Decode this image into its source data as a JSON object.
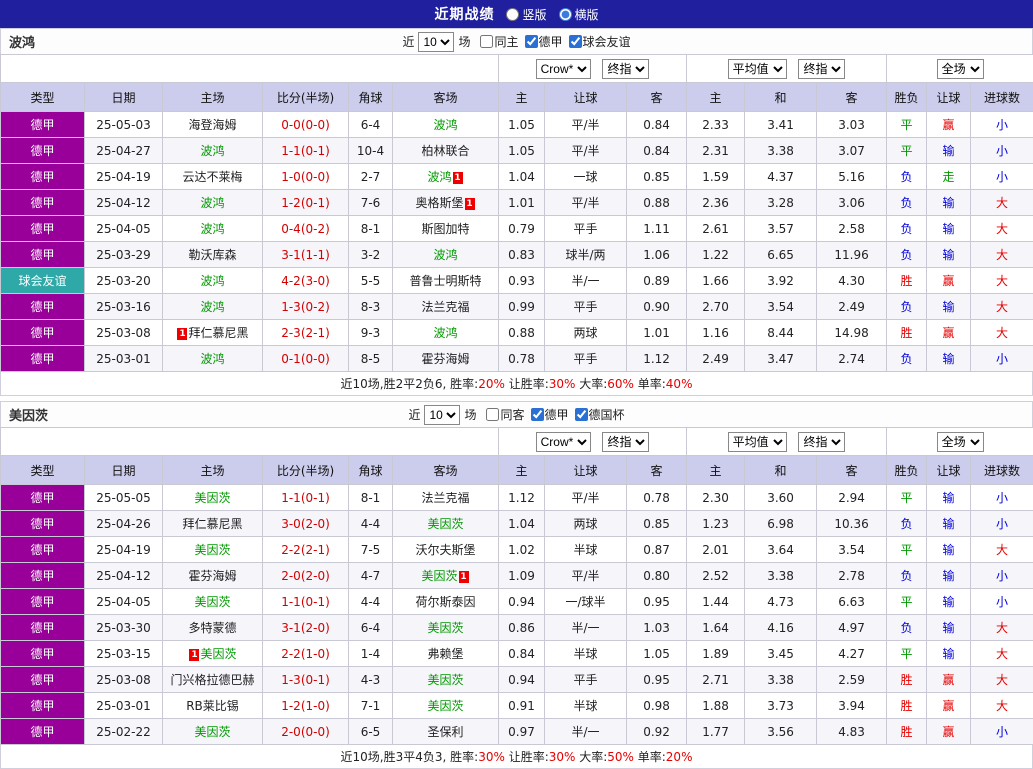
{
  "colors": {
    "title_bg": "#20209e",
    "header_bg": "#ccccec",
    "type_league": "#990099",
    "type_friendly": "#2fa8a8",
    "green": "#009900",
    "red": "#e60000",
    "blue": "#0000dd",
    "score_red": "#d40000"
  },
  "titlebar": {
    "title": "近期战绩",
    "radios": [
      {
        "label": "竖版",
        "selected": false
      },
      {
        "label": "横版",
        "selected": true
      }
    ]
  },
  "headers": [
    "类型",
    "日期",
    "主场",
    "比分(半场)",
    "角球",
    "客场",
    "主",
    "让球",
    "客",
    "主",
    "和",
    "客",
    "胜负",
    "让球",
    "进球数"
  ],
  "tables": [
    {
      "team": "波鸿",
      "filter": {
        "near_label": "近",
        "count": "10",
        "games_label": "场",
        "checks": [
          {
            "label": "同主",
            "checked": false
          },
          {
            "label": "德甲",
            "checked": true
          },
          {
            "label": "球会友谊",
            "checked": true
          }
        ]
      },
      "dropdowns": {
        "asia_company": "Crow*",
        "asia_time": "终指",
        "euro_company": "平均值",
        "euro_time": "终指",
        "scope": "全场"
      },
      "rows": [
        {
          "type": "德甲",
          "type_key": "league",
          "date": "25-05-03",
          "home": {
            "name": "海登海姆",
            "green": false,
            "card": null
          },
          "score": "0-0(0-0)",
          "corner": "6-4",
          "away": {
            "name": "波鸿",
            "green": true,
            "card": null
          },
          "asia": [
            "1.05",
            "平/半",
            "0.84"
          ],
          "europe": [
            "2.33",
            "3.41",
            "3.03"
          ],
          "result": {
            "text": "平",
            "color": "green"
          },
          "handicap": {
            "text": "赢",
            "color": "red"
          },
          "goal": {
            "text": "小",
            "color": "blue"
          }
        },
        {
          "type": "德甲",
          "type_key": "league",
          "date": "25-04-27",
          "home": {
            "name": "波鸿",
            "green": true,
            "card": null
          },
          "score": "1-1(0-1)",
          "corner": "10-4",
          "away": {
            "name": "柏林联合",
            "green": false,
            "card": null
          },
          "asia": [
            "1.05",
            "平/半",
            "0.84"
          ],
          "europe": [
            "2.31",
            "3.38",
            "3.07"
          ],
          "result": {
            "text": "平",
            "color": "green"
          },
          "handicap": {
            "text": "输",
            "color": "blue"
          },
          "goal": {
            "text": "小",
            "color": "blue"
          }
        },
        {
          "type": "德甲",
          "type_key": "league",
          "date": "25-04-19",
          "home": {
            "name": "云达不莱梅",
            "green": false,
            "card": null
          },
          "score": "1-0(0-0)",
          "corner": "2-7",
          "away": {
            "name": "波鸿",
            "green": true,
            "card": "after"
          },
          "asia": [
            "1.04",
            "一球",
            "0.85"
          ],
          "europe": [
            "1.59",
            "4.37",
            "5.16"
          ],
          "result": {
            "text": "负",
            "color": "blue"
          },
          "handicap": {
            "text": "走",
            "color": "green"
          },
          "goal": {
            "text": "小",
            "color": "blue"
          }
        },
        {
          "type": "德甲",
          "type_key": "league",
          "date": "25-04-12",
          "home": {
            "name": "波鸿",
            "green": true,
            "card": null
          },
          "score": "1-2(0-1)",
          "corner": "7-6",
          "away": {
            "name": "奥格斯堡",
            "green": false,
            "card": "after"
          },
          "asia": [
            "1.01",
            "平/半",
            "0.88"
          ],
          "europe": [
            "2.36",
            "3.28",
            "3.06"
          ],
          "result": {
            "text": "负",
            "color": "blue"
          },
          "handicap": {
            "text": "输",
            "color": "blue"
          },
          "goal": {
            "text": "大",
            "color": "red"
          }
        },
        {
          "type": "德甲",
          "type_key": "league",
          "date": "25-04-05",
          "home": {
            "name": "波鸿",
            "green": true,
            "card": null
          },
          "score": "0-4(0-2)",
          "corner": "8-1",
          "away": {
            "name": "斯图加特",
            "green": false,
            "card": null
          },
          "asia": [
            "0.79",
            "平手",
            "1.11"
          ],
          "europe": [
            "2.61",
            "3.57",
            "2.58"
          ],
          "result": {
            "text": "负",
            "color": "blue"
          },
          "handicap": {
            "text": "输",
            "color": "blue"
          },
          "goal": {
            "text": "大",
            "color": "red"
          }
        },
        {
          "type": "德甲",
          "type_key": "league",
          "date": "25-03-29",
          "home": {
            "name": "勒沃库森",
            "green": false,
            "card": null
          },
          "score": "3-1(1-1)",
          "corner": "3-2",
          "away": {
            "name": "波鸿",
            "green": true,
            "card": null
          },
          "asia": [
            "0.83",
            "球半/两",
            "1.06"
          ],
          "europe": [
            "1.22",
            "6.65",
            "11.96"
          ],
          "result": {
            "text": "负",
            "color": "blue"
          },
          "handicap": {
            "text": "输",
            "color": "blue"
          },
          "goal": {
            "text": "大",
            "color": "red"
          }
        },
        {
          "type": "球会友谊",
          "type_key": "friendly",
          "date": "25-03-20",
          "home": {
            "name": "波鸿",
            "green": true,
            "card": null
          },
          "score": "4-2(3-0)",
          "corner": "5-5",
          "away": {
            "name": "普鲁士明斯特",
            "green": false,
            "card": null
          },
          "asia": [
            "0.93",
            "半/一",
            "0.89"
          ],
          "europe": [
            "1.66",
            "3.92",
            "4.30"
          ],
          "result": {
            "text": "胜",
            "color": "red"
          },
          "handicap": {
            "text": "赢",
            "color": "red"
          },
          "goal": {
            "text": "大",
            "color": "red"
          }
        },
        {
          "type": "德甲",
          "type_key": "league",
          "date": "25-03-16",
          "home": {
            "name": "波鸿",
            "green": true,
            "card": null
          },
          "score": "1-3(0-2)",
          "corner": "8-3",
          "away": {
            "name": "法兰克福",
            "green": false,
            "card": null
          },
          "asia": [
            "0.99",
            "平手",
            "0.90"
          ],
          "europe": [
            "2.70",
            "3.54",
            "2.49"
          ],
          "result": {
            "text": "负",
            "color": "blue"
          },
          "handicap": {
            "text": "输",
            "color": "blue"
          },
          "goal": {
            "text": "大",
            "color": "red"
          }
        },
        {
          "type": "德甲",
          "type_key": "league",
          "date": "25-03-08",
          "home": {
            "name": "拜仁慕尼黑",
            "green": false,
            "card": "before"
          },
          "score": "2-3(2-1)",
          "corner": "9-3",
          "away": {
            "name": "波鸿",
            "green": true,
            "card": null
          },
          "asia": [
            "0.88",
            "两球",
            "1.01"
          ],
          "europe": [
            "1.16",
            "8.44",
            "14.98"
          ],
          "result": {
            "text": "胜",
            "color": "red"
          },
          "handicap": {
            "text": "赢",
            "color": "red"
          },
          "goal": {
            "text": "大",
            "color": "red"
          }
        },
        {
          "type": "德甲",
          "type_key": "league",
          "date": "25-03-01",
          "home": {
            "name": "波鸿",
            "green": true,
            "card": null
          },
          "score": "0-1(0-0)",
          "corner": "8-5",
          "away": {
            "name": "霍芬海姆",
            "green": false,
            "card": null
          },
          "asia": [
            "0.78",
            "平手",
            "1.12"
          ],
          "europe": [
            "2.49",
            "3.47",
            "2.74"
          ],
          "result": {
            "text": "负",
            "color": "blue"
          },
          "handicap": {
            "text": "输",
            "color": "blue"
          },
          "goal": {
            "text": "小",
            "color": "blue"
          }
        }
      ],
      "summary": [
        {
          "text": "近10场,胜2平2负6, 胜率:",
          "red": false
        },
        {
          "text": "20%",
          "red": true
        },
        {
          "text": " 让胜率:",
          "red": false
        },
        {
          "text": "30%",
          "red": true
        },
        {
          "text": " 大率:",
          "red": false
        },
        {
          "text": "60%",
          "red": true
        },
        {
          "text": " 单率:",
          "red": false
        },
        {
          "text": "40%",
          "red": true
        }
      ]
    },
    {
      "team": "美因茨",
      "filter": {
        "near_label": "近",
        "count": "10",
        "games_label": "场",
        "checks": [
          {
            "label": "同客",
            "checked": false
          },
          {
            "label": "德甲",
            "checked": true
          },
          {
            "label": "德国杯",
            "checked": true
          }
        ]
      },
      "dropdowns": {
        "asia_company": "Crow*",
        "asia_time": "终指",
        "euro_company": "平均值",
        "euro_time": "终指",
        "scope": "全场"
      },
      "rows": [
        {
          "type": "德甲",
          "type_key": "league",
          "date": "25-05-05",
          "home": {
            "name": "美因茨",
            "green": true,
            "card": null
          },
          "score": "1-1(0-1)",
          "corner": "8-1",
          "away": {
            "name": "法兰克福",
            "green": false,
            "card": null
          },
          "asia": [
            "1.12",
            "平/半",
            "0.78"
          ],
          "europe": [
            "2.30",
            "3.60",
            "2.94"
          ],
          "result": {
            "text": "平",
            "color": "green"
          },
          "handicap": {
            "text": "输",
            "color": "blue"
          },
          "goal": {
            "text": "小",
            "color": "blue"
          }
        },
        {
          "type": "德甲",
          "type_key": "league",
          "date": "25-04-26",
          "home": {
            "name": "拜仁慕尼黑",
            "green": false,
            "card": null
          },
          "score": "3-0(2-0)",
          "corner": "4-4",
          "away": {
            "name": "美因茨",
            "green": true,
            "card": null
          },
          "asia": [
            "1.04",
            "两球",
            "0.85"
          ],
          "europe": [
            "1.23",
            "6.98",
            "10.36"
          ],
          "result": {
            "text": "负",
            "color": "blue"
          },
          "handicap": {
            "text": "输",
            "color": "blue"
          },
          "goal": {
            "text": "小",
            "color": "blue"
          }
        },
        {
          "type": "德甲",
          "type_key": "league",
          "date": "25-04-19",
          "home": {
            "name": "美因茨",
            "green": true,
            "card": null
          },
          "score": "2-2(2-1)",
          "corner": "7-5",
          "away": {
            "name": "沃尔夫斯堡",
            "green": false,
            "card": null
          },
          "asia": [
            "1.02",
            "半球",
            "0.87"
          ],
          "europe": [
            "2.01",
            "3.64",
            "3.54"
          ],
          "result": {
            "text": "平",
            "color": "green"
          },
          "handicap": {
            "text": "输",
            "color": "blue"
          },
          "goal": {
            "text": "大",
            "color": "red"
          }
        },
        {
          "type": "德甲",
          "type_key": "league",
          "date": "25-04-12",
          "home": {
            "name": "霍芬海姆",
            "green": false,
            "card": null
          },
          "score": "2-0(2-0)",
          "corner": "4-7",
          "away": {
            "name": "美因茨",
            "green": true,
            "card": "after"
          },
          "asia": [
            "1.09",
            "平/半",
            "0.80"
          ],
          "europe": [
            "2.52",
            "3.38",
            "2.78"
          ],
          "result": {
            "text": "负",
            "color": "blue"
          },
          "handicap": {
            "text": "输",
            "color": "blue"
          },
          "goal": {
            "text": "小",
            "color": "blue"
          }
        },
        {
          "type": "德甲",
          "type_key": "league",
          "date": "25-04-05",
          "home": {
            "name": "美因茨",
            "green": true,
            "card": null
          },
          "score": "1-1(0-1)",
          "corner": "4-4",
          "away": {
            "name": "荷尔斯泰因",
            "green": false,
            "card": null
          },
          "asia": [
            "0.94",
            "一/球半",
            "0.95"
          ],
          "europe": [
            "1.44",
            "4.73",
            "6.63"
          ],
          "result": {
            "text": "平",
            "color": "green"
          },
          "handicap": {
            "text": "输",
            "color": "blue"
          },
          "goal": {
            "text": "小",
            "color": "blue"
          }
        },
        {
          "type": "德甲",
          "type_key": "league",
          "date": "25-03-30",
          "home": {
            "name": "多特蒙德",
            "green": false,
            "card": null
          },
          "score": "3-1(2-0)",
          "corner": "6-4",
          "away": {
            "name": "美因茨",
            "green": true,
            "card": null
          },
          "asia": [
            "0.86",
            "半/一",
            "1.03"
          ],
          "europe": [
            "1.64",
            "4.16",
            "4.97"
          ],
          "result": {
            "text": "负",
            "color": "blue"
          },
          "handicap": {
            "text": "输",
            "color": "blue"
          },
          "goal": {
            "text": "大",
            "color": "red"
          }
        },
        {
          "type": "德甲",
          "type_key": "league",
          "date": "25-03-15",
          "home": {
            "name": "美因茨",
            "green": true,
            "card": "before"
          },
          "score": "2-2(1-0)",
          "corner": "1-4",
          "away": {
            "name": "弗赖堡",
            "green": false,
            "card": null
          },
          "asia": [
            "0.84",
            "半球",
            "1.05"
          ],
          "europe": [
            "1.89",
            "3.45",
            "4.27"
          ],
          "result": {
            "text": "平",
            "color": "green"
          },
          "handicap": {
            "text": "输",
            "color": "blue"
          },
          "goal": {
            "text": "大",
            "color": "red"
          }
        },
        {
          "type": "德甲",
          "type_key": "league",
          "date": "25-03-08",
          "home": {
            "name": "门兴格拉德巴赫",
            "green": false,
            "card": null
          },
          "score": "1-3(0-1)",
          "corner": "4-3",
          "away": {
            "name": "美因茨",
            "green": true,
            "card": null
          },
          "asia": [
            "0.94",
            "平手",
            "0.95"
          ],
          "europe": [
            "2.71",
            "3.38",
            "2.59"
          ],
          "result": {
            "text": "胜",
            "color": "red"
          },
          "handicap": {
            "text": "赢",
            "color": "red"
          },
          "goal": {
            "text": "大",
            "color": "red"
          }
        },
        {
          "type": "德甲",
          "type_key": "league",
          "date": "25-03-01",
          "home": {
            "name": "RB莱比锡",
            "green": false,
            "card": null
          },
          "score": "1-2(1-0)",
          "corner": "7-1",
          "away": {
            "name": "美因茨",
            "green": true,
            "card": null
          },
          "asia": [
            "0.91",
            "半球",
            "0.98"
          ],
          "europe": [
            "1.88",
            "3.73",
            "3.94"
          ],
          "result": {
            "text": "胜",
            "color": "red"
          },
          "handicap": {
            "text": "赢",
            "color": "red"
          },
          "goal": {
            "text": "大",
            "color": "red"
          }
        },
        {
          "type": "德甲",
          "type_key": "league",
          "date": "25-02-22",
          "home": {
            "name": "美因茨",
            "green": true,
            "card": null
          },
          "score": "2-0(0-0)",
          "corner": "6-5",
          "away": {
            "name": "圣保利",
            "green": false,
            "card": null
          },
          "asia": [
            "0.97",
            "半/一",
            "0.92"
          ],
          "europe": [
            "1.77",
            "3.56",
            "4.83"
          ],
          "result": {
            "text": "胜",
            "color": "red"
          },
          "handicap": {
            "text": "赢",
            "color": "red"
          },
          "goal": {
            "text": "小",
            "color": "blue"
          }
        }
      ],
      "summary": [
        {
          "text": "近10场,胜3平4负3, 胜率:",
          "red": false
        },
        {
          "text": "30%",
          "red": true
        },
        {
          "text": " 让胜率:",
          "red": false
        },
        {
          "text": "30%",
          "red": true
        },
        {
          "text": " 大率:",
          "red": false
        },
        {
          "text": "50%",
          "red": true
        },
        {
          "text": " 单率:",
          "red": false
        },
        {
          "text": "20%",
          "red": true
        }
      ]
    }
  ]
}
